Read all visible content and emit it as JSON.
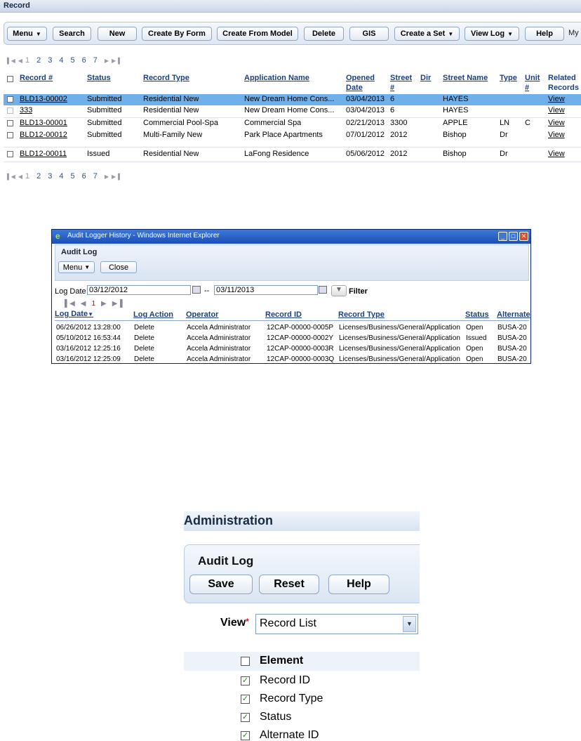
{
  "record_panel": {
    "title": "Record",
    "toolbar": [
      {
        "label": "Menu",
        "caret": true
      },
      {
        "label": "Search"
      },
      {
        "label": "New"
      },
      {
        "label": "Create By Form"
      },
      {
        "label": "Create From Model"
      },
      {
        "label": "Delete"
      },
      {
        "label": "GIS"
      },
      {
        "label": "Create a Set",
        "caret": true
      },
      {
        "label": "View Log",
        "caret": true
      },
      {
        "label": "Help"
      }
    ],
    "toolbar_overflow_text": "My",
    "pager_top": {
      "pages": [
        "1",
        "2",
        "3",
        "4",
        "5",
        "6",
        "7"
      ],
      "current": "1"
    },
    "pager_bottom": {
      "pages": [
        "1",
        "2",
        "3",
        "4",
        "5",
        "6",
        "7"
      ],
      "current": "1"
    },
    "columns": {
      "record": "Record #",
      "status": "Status",
      "record_type": "Record Type",
      "application_name": "Application Name",
      "opened_date_1": "Opened",
      "opened_date_2": "Date",
      "street_1": "Street",
      "street_2": "#",
      "dir": "Dir",
      "street_name": "Street Name",
      "type": "Type",
      "unit_1": "Unit",
      "unit_2": "#",
      "related_1": "Related",
      "related_2": "Records"
    },
    "rows": [
      {
        "record": "BLD13-00002",
        "status": "Submitted",
        "record_type": "Residential New",
        "application_name": "New Dream Home Cons...",
        "opened": "03/04/2013",
        "street": "6",
        "dir": "",
        "street_name": "HAYES",
        "type": "",
        "unit": "",
        "related": "View",
        "selected": true
      },
      {
        "record": "333",
        "status": "Submitted",
        "record_type": "Residential New",
        "application_name": "New Dream Home Cons...",
        "opened": "03/04/2013",
        "street": "6",
        "dir": "",
        "street_name": "HAYES",
        "type": "",
        "unit": "",
        "related": "View"
      },
      {
        "record": "BLD13-00001",
        "status": "Submitted",
        "record_type": "Commercial Pool-Spa",
        "application_name": "Commercial Spa",
        "opened": "02/21/2013",
        "street": "3300",
        "dir": "",
        "street_name": "APPLE",
        "type": "LN",
        "unit": "C",
        "related": "View"
      },
      {
        "record": "BLD12-00012",
        "status": "Submitted",
        "record_type": "Multi-Family New",
        "application_name": "Park Place Apartments",
        "opened": "07/01/2012",
        "street": "2012",
        "dir": "",
        "street_name": "Bishop",
        "type": "Dr",
        "unit": "",
        "related": "View"
      },
      {
        "record": "BLD12-00011",
        "status": "Issued",
        "record_type": "Residential New",
        "application_name": "LaFong Residence",
        "opened": "05/06/2012",
        "street": "2012",
        "dir": "",
        "street_name": "Bishop",
        "type": "Dr",
        "unit": "",
        "related": "View"
      }
    ]
  },
  "audit_window": {
    "window_title": "Audit Logger History - Windows Internet Explorer",
    "heading": "Audit Log",
    "menu_label": "Menu",
    "close_label": "Close",
    "log_date_label": "Log Date",
    "date_from": "03/12/2012",
    "date_separator": "--",
    "date_to": "03/11/2013",
    "filter_label": "Filter",
    "pager_current": "1",
    "columns": {
      "log_date": "Log Date",
      "log_action": "Log Action",
      "operator": "Operator",
      "record_id": "Record ID",
      "record_type": "Record Type",
      "status": "Status",
      "alternate": "Alternate"
    },
    "rows": [
      {
        "log_date": "06/26/2012 13:28:00",
        "log_action": "Delete",
        "operator": "Accela Administrator",
        "record_id": "12CAP-00000-0005P",
        "record_type": "Licenses/Business/General/Application",
        "status": "Open",
        "alternate": "BUSA-20"
      },
      {
        "log_date": "05/10/2012 16:53:44",
        "log_action": "Delete",
        "operator": "Accela Administrator",
        "record_id": "12CAP-00000-0002Y",
        "record_type": "Licenses/Business/General/Application",
        "status": "Issued",
        "alternate": "BUSA-20"
      },
      {
        "log_date": "03/16/2012 12:25:16",
        "log_action": "Delete",
        "operator": "Accela Administrator",
        "record_id": "12CAP-00000-0003R",
        "record_type": "Licenses/Business/General/Application",
        "status": "Open",
        "alternate": "BUSA-20"
      },
      {
        "log_date": "03/16/2012 12:25:09",
        "log_action": "Delete",
        "operator": "Accela Administrator",
        "record_id": "12CAP-00000-0003Q",
        "record_type": "Licenses/Business/General/Application",
        "status": "Open",
        "alternate": "BUSA-20"
      }
    ]
  },
  "admin_panel": {
    "title": "Administration",
    "heading": "Audit Log",
    "buttons": {
      "save": "Save",
      "reset": "Reset",
      "help": "Help"
    },
    "view_label": "View",
    "required_marker": "*",
    "view_value": "Record List",
    "element_header": "Element",
    "elements": [
      {
        "label": "Record ID",
        "checked": true
      },
      {
        "label": "Record Type",
        "checked": true
      },
      {
        "label": "Status",
        "checked": true
      },
      {
        "label": "Alternate ID",
        "checked": true
      }
    ]
  },
  "colors": {
    "selected_row": "#6fb0ea",
    "link_header": "#1b3f80",
    "toolbar_border": "#b3c6e0",
    "ie_titlebar": "#1c4fb8",
    "check_green": "#1a8a1a"
  }
}
